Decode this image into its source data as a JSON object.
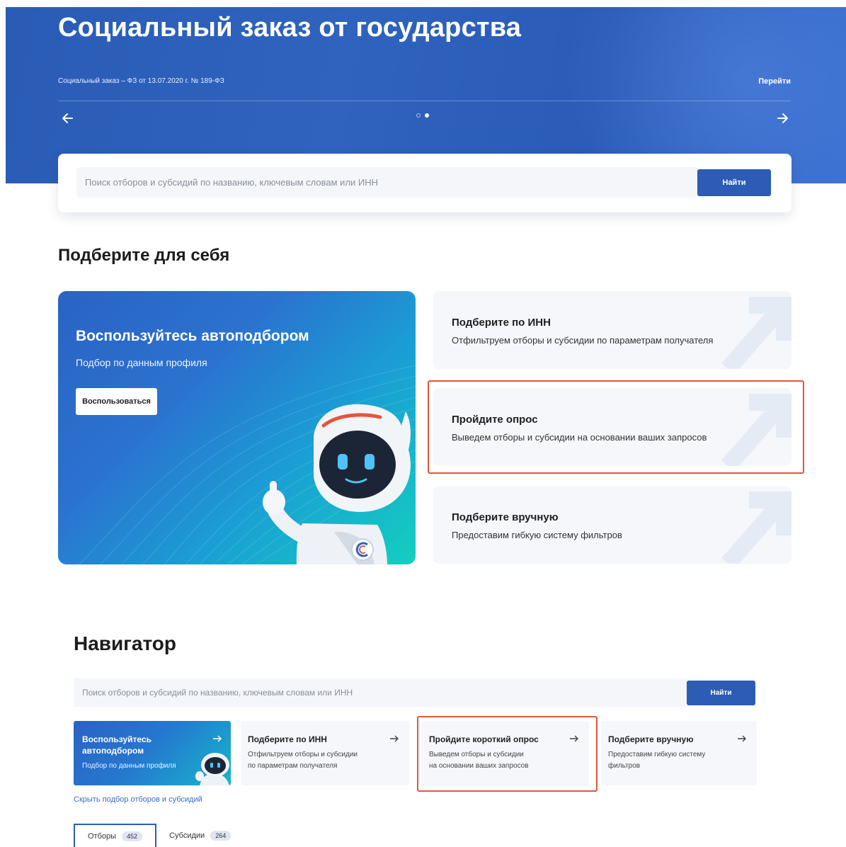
{
  "hero": {
    "title": "Социальный заказ от государства",
    "subtitle": "Социальный заказ – ФЗ от 13.07.2020 г. № 189-ФЗ",
    "go_label": "Перейти"
  },
  "search": {
    "placeholder": "Поиск отборов и субсидий по названию, ключевым словам или ИНН",
    "button_label": "Найти"
  },
  "pick_section": {
    "title": "Подберите для себя",
    "auto": {
      "title": "Воспользуйтесь автоподбором",
      "subtitle": "Подбор по данным профиля",
      "button_label": "Воспользоваться"
    },
    "options": [
      {
        "title": "Подберите по ИНН",
        "desc": "Отфильтруем отборы и субсидии по параметрам получателя"
      },
      {
        "title": "Пройдите опрос",
        "desc": "Выведем отборы и субсидии на основании ваших запросов"
      },
      {
        "title": "Подберите вручную",
        "desc": "Предоставим гибкую систему фильтров"
      }
    ]
  },
  "navigator": {
    "title": "Навигатор",
    "search_placeholder": "Поиск отборов и субсидий по названию, ключевым словам или ИНН",
    "search_button": "Найти",
    "cards": [
      {
        "title_1": "Воспользуйтесь",
        "title_2": "автоподбором",
        "desc": "Подбор по данным профиля"
      },
      {
        "title": "Подберите по ИНН",
        "desc_1": "Отфильтруем отборы и субсидии",
        "desc_2": "по параметрам получателя"
      },
      {
        "title": "Пройдите короткий опрос",
        "desc_1": "Выведем отборы и субсидии",
        "desc_2": "на основании ваших запросов"
      },
      {
        "title": "Подберите вручную",
        "desc_1": "Предоставим гибкую систему",
        "desc_2": "фильтров"
      }
    ],
    "hide_link": "Скрыть подбор отборов и субсидий",
    "tabs": [
      {
        "label": "Отборы",
        "count": "452"
      },
      {
        "label": "Субсидии",
        "count": "264"
      }
    ]
  },
  "colors": {
    "primary": "#2c5cb5",
    "highlight_frame": "#e2563f",
    "card_bg": "#f5f7fa"
  }
}
